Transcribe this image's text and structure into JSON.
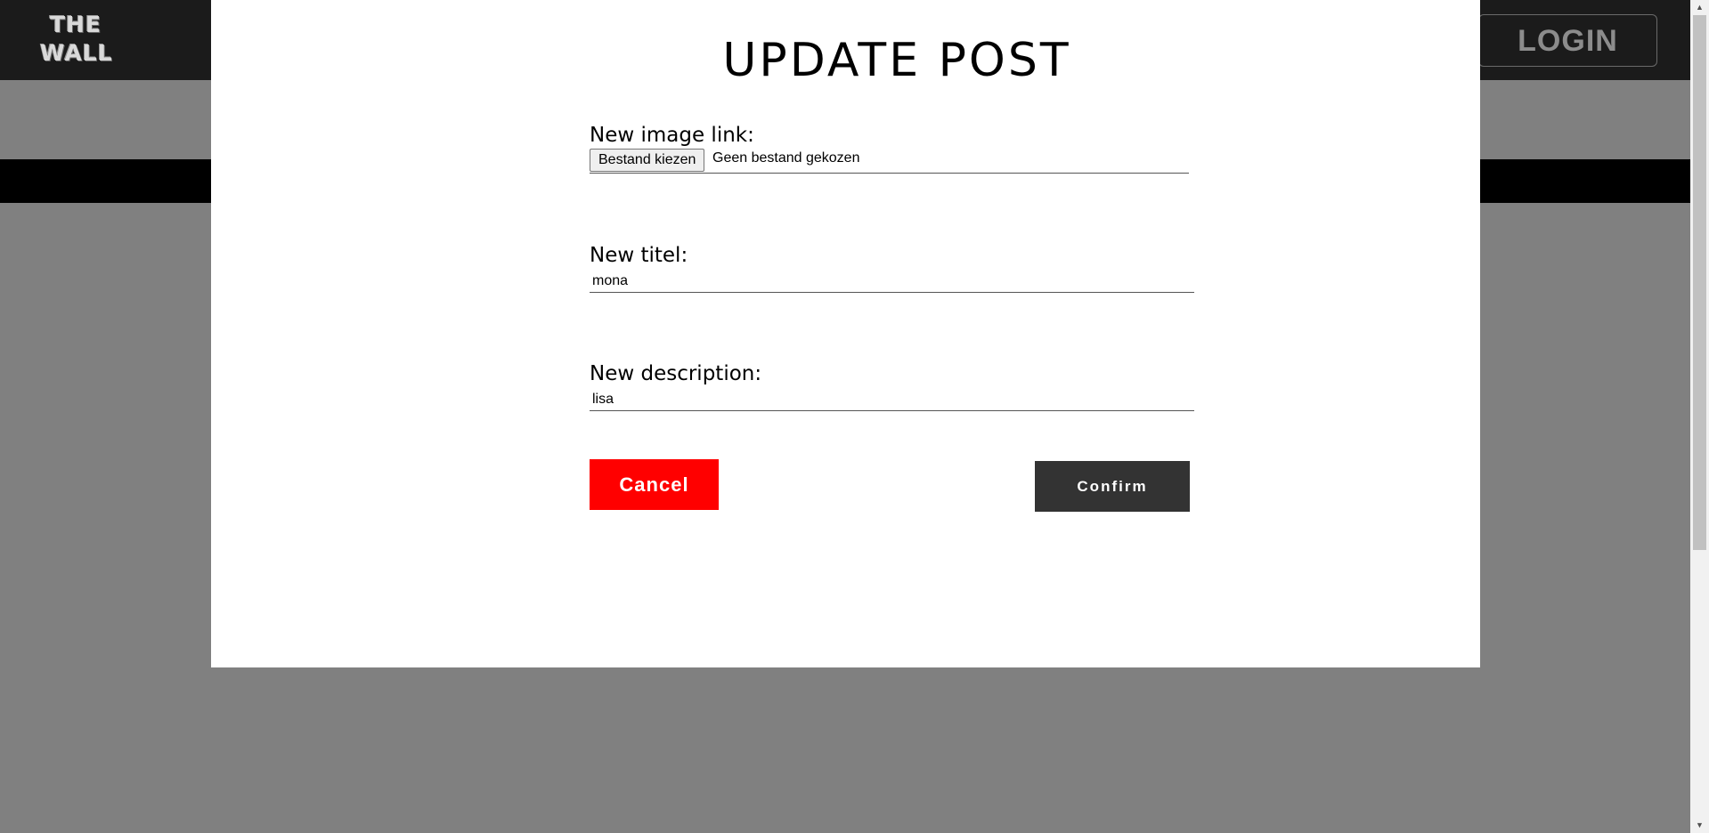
{
  "header": {
    "logo_line1": "THE",
    "logo_line2": "WALL",
    "login_label": "LOGIN"
  },
  "modal": {
    "title": "UPDATE POST",
    "image_field": {
      "label": "New image link:",
      "button_label": "Bestand kiezen",
      "status": "Geen bestand gekozen"
    },
    "title_field": {
      "label": "New titel:",
      "value": "mona"
    },
    "description_field": {
      "label": "New description:",
      "value": "lisa"
    },
    "cancel_label": "Cancel",
    "confirm_label": "Confirm"
  },
  "colors": {
    "header_bg": "#1b1b1b",
    "overlay_bg": "#808080",
    "cancel_bg": "#ff0000",
    "confirm_bg": "#333333"
  },
  "icons": {
    "scroll_up": "triangle-up",
    "scroll_down": "triangle-down"
  }
}
